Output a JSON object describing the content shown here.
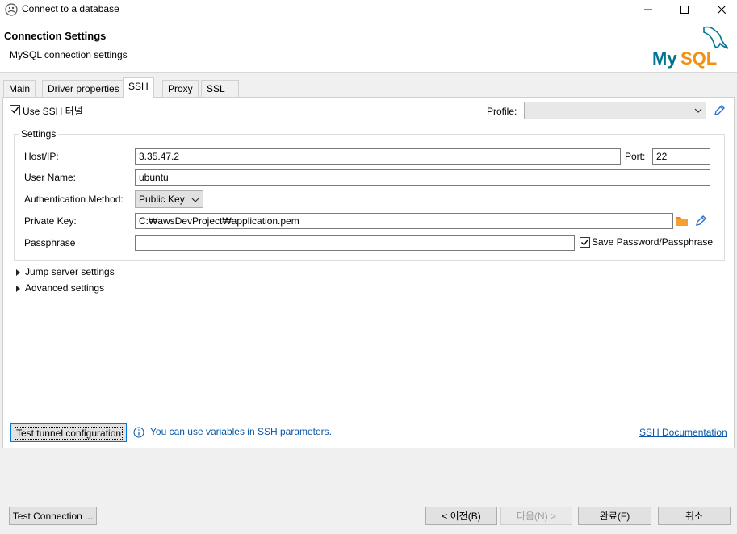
{
  "window": {
    "title": "Connect to a database",
    "controls": [
      "minimize",
      "maximize",
      "close"
    ]
  },
  "header": {
    "title": "Connection Settings",
    "subtitle": "MySQL connection settings",
    "logo_text": "MySQL"
  },
  "tabs": [
    {
      "label": "Main"
    },
    {
      "label": "Driver properties"
    },
    {
      "label": "SSH",
      "active": true
    },
    {
      "label": "Proxy"
    },
    {
      "label": "SSL"
    }
  ],
  "ssh": {
    "use_ssh_label": "Use SSH 터널",
    "use_ssh_checked": true,
    "profile_label": "Profile:",
    "profile_value": "",
    "settings_group_label": "Settings",
    "host_label": "Host/IP:",
    "host_value": "3.35.47.2",
    "port_label": "Port:",
    "port_value": "22",
    "user_label": "User Name:",
    "user_value": "ubuntu",
    "auth_label": "Authentication Method:",
    "auth_value": "Public Key",
    "private_key_label": "Private Key:",
    "private_key_value": "C:₩awsDevProject₩application.pem",
    "passphrase_label": "Passphrase",
    "passphrase_value": "",
    "save_password_label": "Save Password/Passphrase",
    "save_password_checked": true,
    "jump_server_label": "Jump server settings",
    "advanced_label": "Advanced settings",
    "test_tunnel_label": "Test tunnel configuration",
    "variables_hint": "You can use variables in SSH parameters.",
    "ssh_doc_link": "SSH Documentation"
  },
  "footer": {
    "test_connection": "Test Connection ...",
    "prev": "< 이전(B)",
    "next": "다음(N) >",
    "finish": "완료(F)",
    "cancel": "취소"
  },
  "colors": {
    "accent_link": "#0b57a4",
    "folder_icon": "#e8891c",
    "pencil_icon": "#2a6fd6",
    "mysql_blue": "#00758f",
    "mysql_orange": "#f29111"
  }
}
